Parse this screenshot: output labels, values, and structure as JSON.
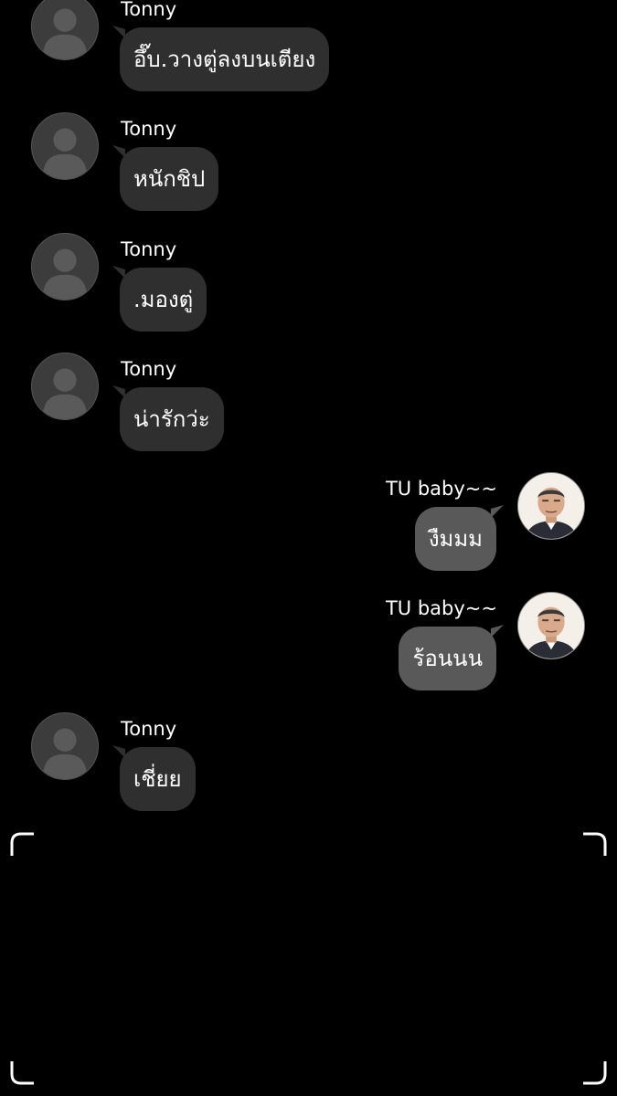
{
  "messages": [
    {
      "sender": "Tonny",
      "text": "อึ๊บ.วางตู่ลงบนเตียง",
      "direction": "in",
      "avatar": "default-person-icon"
    },
    {
      "sender": "Tonny",
      "text": "หนักชิป",
      "direction": "in",
      "avatar": "default-person-icon"
    },
    {
      "sender": "Tonny",
      "text": ".มองตู่",
      "direction": "in",
      "avatar": "default-person-icon"
    },
    {
      "sender": "Tonny",
      "text": "น่ารักว่ะ",
      "direction": "in",
      "avatar": "default-person-icon"
    },
    {
      "sender": "TU baby~~",
      "text": "งืมมม",
      "direction": "out",
      "avatar": "user-photo-avatar"
    },
    {
      "sender": "TU baby~~",
      "text": "ร้อนนน",
      "direction": "out",
      "avatar": "user-photo-avatar"
    },
    {
      "sender": "Tonny",
      "text": "เชี่ยย",
      "direction": "in",
      "avatar": "default-person-icon"
    }
  ],
  "colors": {
    "background": "#000000",
    "incoming_bubble": "#2f2f2f",
    "outgoing_bubble": "#595959",
    "text": "#ffffff"
  }
}
